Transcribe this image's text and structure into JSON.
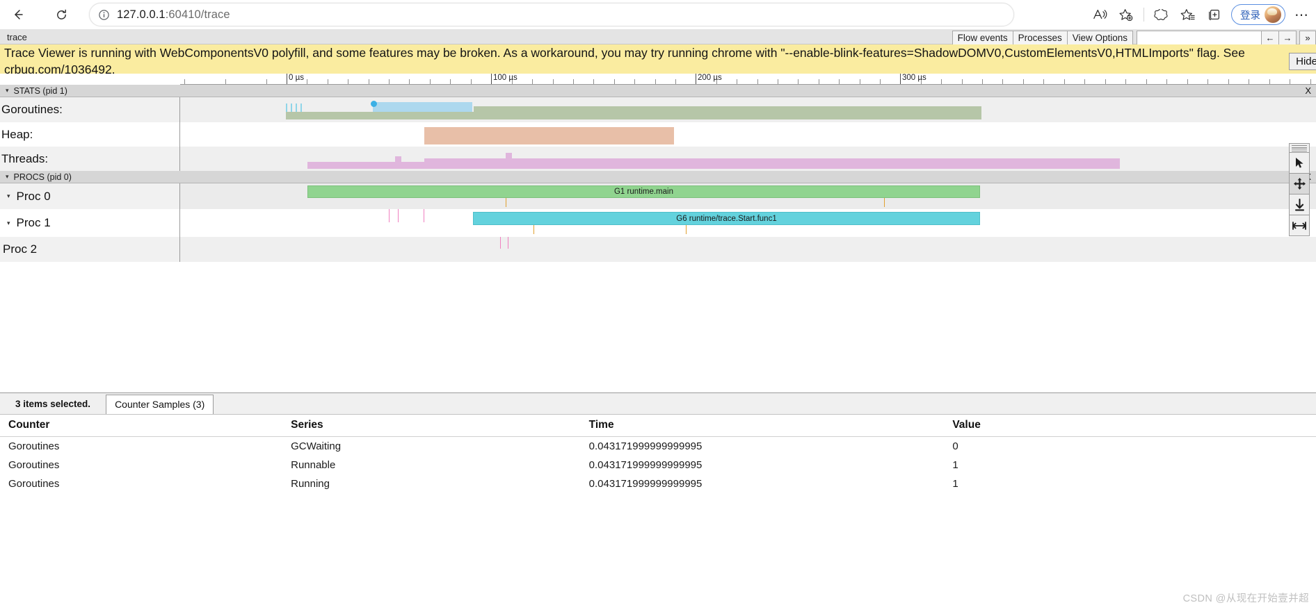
{
  "browser": {
    "url_host": "127.0.0.1",
    "url_port": ":60410",
    "url_path": "/trace",
    "back_label": "←",
    "reload_label": "↻",
    "info_title": "Site information",
    "read_aloud_title": "Read this page aloud",
    "favorite_title": "Add this page to favorites",
    "copilot_title": "Browser essentials",
    "favorites_title": "Favorites",
    "collections_title": "Collections",
    "signin_label": "登录",
    "more_label": "⋯"
  },
  "tracebar": {
    "title": "trace",
    "flow_events": "Flow events",
    "processes": "Processes",
    "view_options": "View Options",
    "search_value": "",
    "prev_label": "←",
    "next_label": "→",
    "more_label": "»"
  },
  "warning": {
    "text": "Trace Viewer is running with WebComponentsV0 polyfill, and some features may be broken. As a workaround, you may try running chrome with \"--enable-blink-features=ShadowDOMV0,CustomElementsV0,HTMLImports\" flag. See crbug.com/1036492.",
    "hide_label": "Hide",
    "background": "#faeca0"
  },
  "ruler": {
    "labels": [
      {
        "text": "0 µs",
        "x": 412
      },
      {
        "text": "100 µs",
        "x": 706
      },
      {
        "text": "200 µs",
        "x": 1000
      },
      {
        "text": "300 µs",
        "x": 1294
      }
    ],
    "minor_ticks": [
      265,
      324,
      383,
      441,
      471,
      500,
      530,
      559,
      588,
      618,
      647,
      677,
      736,
      765,
      795,
      824,
      853,
      883,
      912,
      942,
      971,
      1030,
      1059,
      1089,
      1118,
      1147,
      1177,
      1206,
      1236,
      1265,
      1324,
      1353,
      1383,
      1412,
      1441,
      1471,
      1500,
      1530,
      1559,
      1589,
      1618,
      1648,
      1677,
      1707,
      1736,
      1766,
      1795,
      1825,
      1854,
      1884
    ]
  },
  "groups": {
    "stats": {
      "caret": "▾",
      "label": "STATS (pid 1)",
      "close": "X"
    },
    "procs": {
      "caret": "▾",
      "label": "PROCS (pid 0)",
      "close": "X"
    }
  },
  "rows": [
    {
      "name": "goroutines",
      "label": "Goroutines:",
      "caret": ""
    },
    {
      "name": "heap",
      "label": "Heap:",
      "caret": ""
    },
    {
      "name": "threads",
      "label": "Threads:",
      "caret": ""
    },
    {
      "name": "proc0",
      "label": "Proc 0",
      "caret": "▾"
    },
    {
      "name": "proc1",
      "label": "Proc 1",
      "caret": "▾"
    },
    {
      "name": "proc2",
      "label": "Proc 2",
      "caret": ""
    }
  ],
  "slices": {
    "proc0_label": "G1 runtime.main",
    "proc1_label": "G6 runtime/trace.Start.func1"
  },
  "colors": {
    "goroutine_green": "#b6c6a8",
    "goroutine_blue": "#add8ee",
    "goroutine_cyan": "#8fd5e8",
    "heap_salmon": "#e8bfa8",
    "threads_pink": "#e0b6dd",
    "proc0_green": "#90d48f",
    "proc1_cyan": "#63d2dd",
    "marker_pink": "#f080c0",
    "marker_orange": "#e0a030",
    "warning_yellow": "#faeca0",
    "selection_dot": "#3bb0e5"
  },
  "navtools": {
    "select_title": "Selection mode",
    "pan_title": "Pan mode",
    "zoom_title": "Zoom mode",
    "timing_title": "Timing mode"
  },
  "analysis": {
    "selection_count": "3 items selected.",
    "tab_label": "Counter Samples (3)",
    "columns": [
      "Counter",
      "Series",
      "Time",
      "Value"
    ],
    "rows": [
      {
        "counter": "Goroutines",
        "series": "GCWaiting",
        "time": "0.043171999999999995",
        "value": "0"
      },
      {
        "counter": "Goroutines",
        "series": "Runnable",
        "time": "0.043171999999999995",
        "value": "1"
      },
      {
        "counter": "Goroutines",
        "series": "Running",
        "time": "0.043171999999999995",
        "value": "1"
      }
    ]
  },
  "watermark": "CSDN @从现在开始壹并超"
}
